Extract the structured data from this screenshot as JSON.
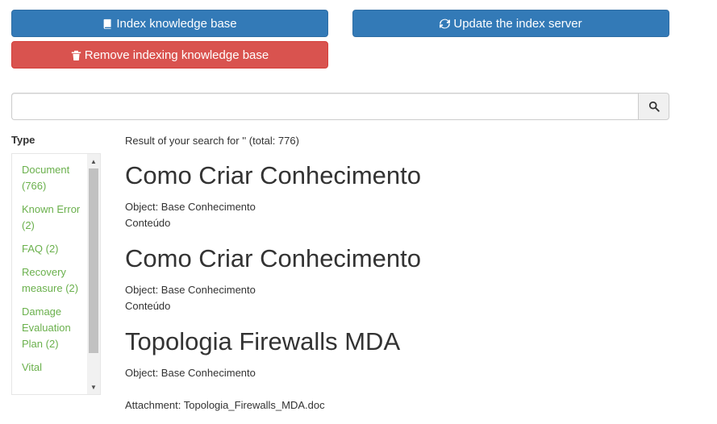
{
  "actions": {
    "index_label": "Index knowledge base",
    "update_label": "Update the index server",
    "remove_label": "Remove indexing knowledge base",
    "primary_color": "#337ab7",
    "danger_color": "#d9534f"
  },
  "search": {
    "value": "",
    "placeholder": "",
    "button_icon": "search-icon"
  },
  "filters": {
    "title": "Type",
    "items": [
      "Document (766)",
      "Known Error (2)",
      "FAQ (2)",
      "Recovery measure (2)",
      "Damage Evaluation Plan (2)",
      "Vital"
    ],
    "link_color": "#6ab04c"
  },
  "results": {
    "summary": "Result of your search for '' (total: 776)",
    "items": [
      {
        "title": "Como Criar Conhecimento",
        "object": "Object: Base Conhecimento",
        "content": "Conteúdo"
      },
      {
        "title": "Como Criar Conhecimento",
        "object": "Object: Base Conhecimento",
        "content": "Conteúdo"
      },
      {
        "title": "Topologia Firewalls MDA",
        "object": "Object: Base Conhecimento",
        "attachment": "Attachment: Topologia_Firewalls_MDA.doc"
      }
    ]
  }
}
